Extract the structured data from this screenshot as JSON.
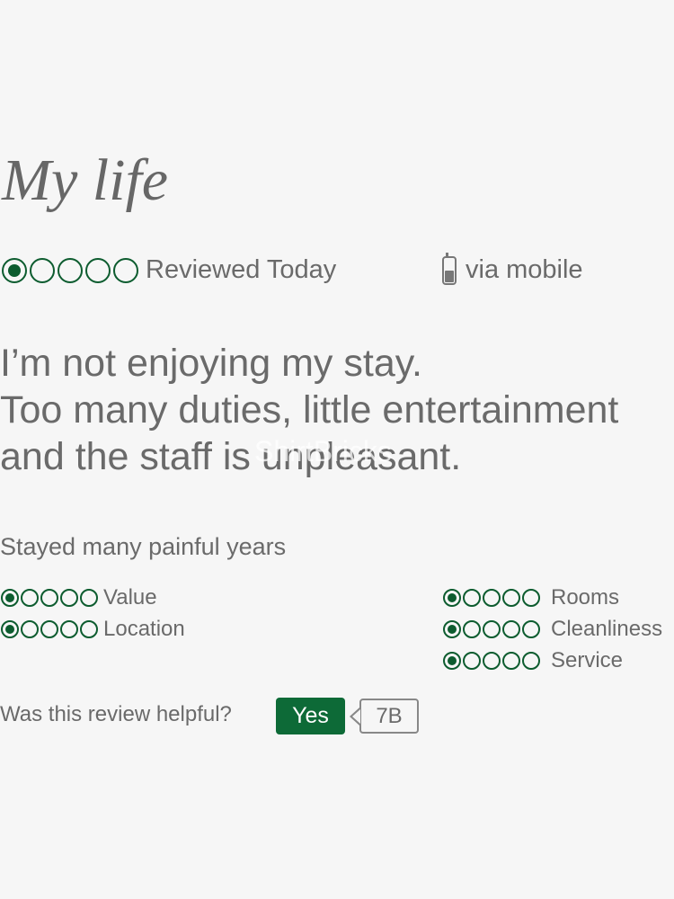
{
  "review": {
    "title": "My life",
    "overall_rating": {
      "value": 1,
      "max": 5
    },
    "date_text": "Reviewed Today",
    "source_icon": "mobile-phone-icon",
    "source_text": "via mobile",
    "body_lines": [
      "I’m not enjoying my stay.",
      "Too many duties, little entertainment",
      "and the staff is unpleasant."
    ],
    "stay_text": "Stayed many painful years",
    "sub_ratings": [
      {
        "label": "Value",
        "value": 1,
        "max": 5
      },
      {
        "label": "Location",
        "value": 1,
        "max": 5
      },
      {
        "label": "Rooms",
        "value": 1,
        "max": 5
      },
      {
        "label": "Cleanliness",
        "value": 1,
        "max": 5
      },
      {
        "label": "Service",
        "value": 1,
        "max": 5
      }
    ],
    "helpful_question": "Was this review helpful?",
    "helpful_button_label": "Yes",
    "helpful_count": "7B"
  },
  "watermark": "ShirtBricks",
  "colors": {
    "accent": "#0d5c2f",
    "button": "#0d6a37",
    "text": "#6a6a6a",
    "background": "#f6f6f6"
  }
}
